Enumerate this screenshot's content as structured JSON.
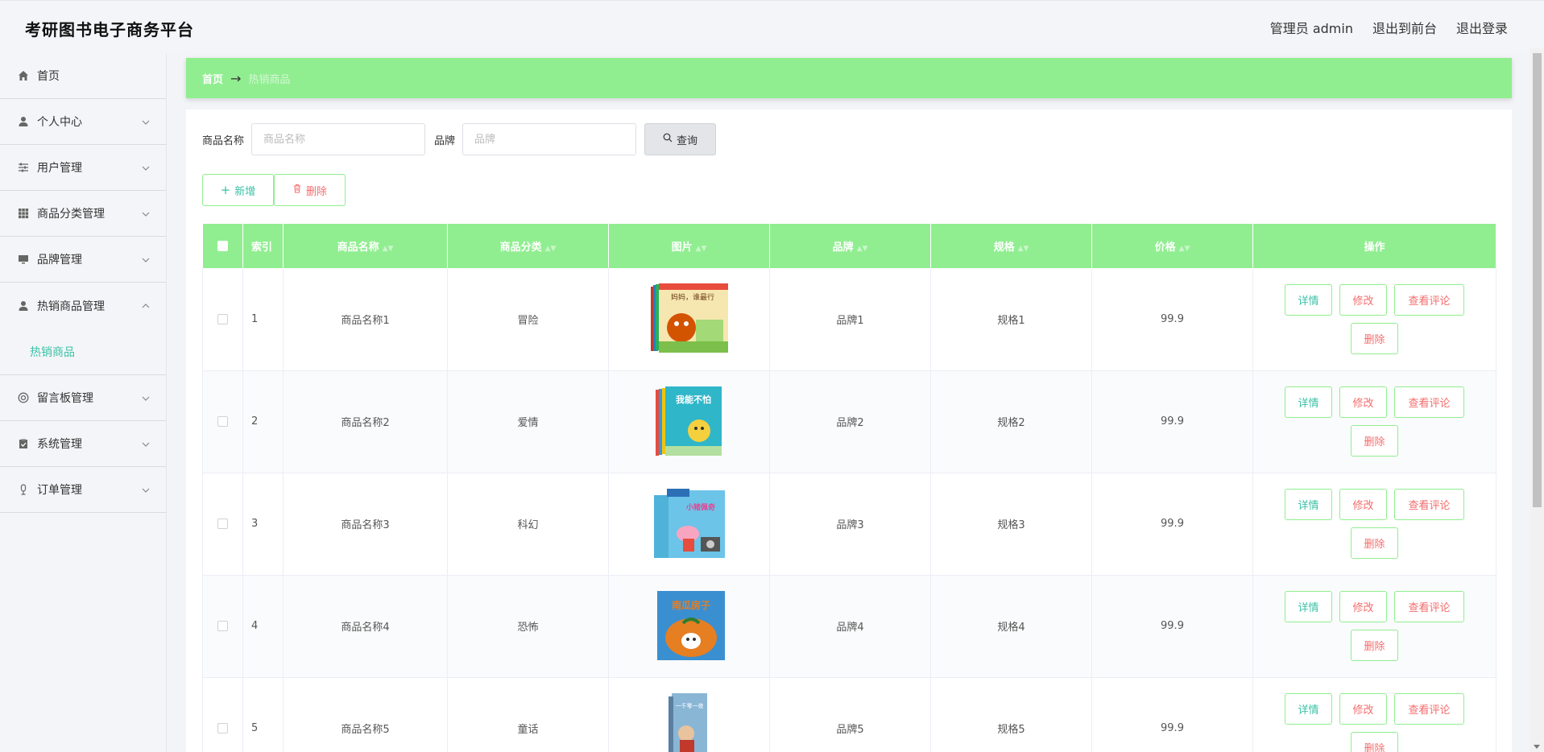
{
  "header": {
    "brand": "考研图书电子商务平台",
    "user_label": "管理员 admin",
    "to_front": "退出到前台",
    "logout": "退出登录"
  },
  "sidebar": {
    "items": [
      {
        "label": "首页",
        "icon": "home-icon"
      },
      {
        "label": "个人中心",
        "icon": "user-icon"
      },
      {
        "label": "用户管理",
        "icon": "sliders-icon"
      },
      {
        "label": "商品分类管理",
        "icon": "grid-icon"
      },
      {
        "label": "品牌管理",
        "icon": "monitor-icon"
      },
      {
        "label": "热销商品管理",
        "icon": "user-icon"
      },
      {
        "label": "留言板管理",
        "icon": "help-icon"
      },
      {
        "label": "系统管理",
        "icon": "clipboard-icon"
      },
      {
        "label": "订单管理",
        "icon": "mic-icon"
      }
    ],
    "submenu_active": "热销商品"
  },
  "breadcrumb": {
    "home": "首页",
    "arrow": "→",
    "current": "热销商品"
  },
  "search": {
    "name_label": "商品名称",
    "name_placeholder": "商品名称",
    "brand_label": "品牌",
    "brand_placeholder": "品牌",
    "query_label": "查询"
  },
  "actions": {
    "add_label": "新增",
    "delete_label": "删除"
  },
  "table": {
    "headers": [
      "索引",
      "商品名称",
      "商品分类",
      "图片",
      "品牌",
      "规格",
      "价格",
      "操作"
    ],
    "rows": [
      {
        "index": "1",
        "name": "商品名称1",
        "category": "冒险",
        "brand": "品牌1",
        "spec": "规格1",
        "price": "99.9"
      },
      {
        "index": "2",
        "name": "商品名称2",
        "category": "爱情",
        "brand": "品牌2",
        "spec": "规格2",
        "price": "99.9"
      },
      {
        "index": "3",
        "name": "商品名称3",
        "category": "科幻",
        "brand": "品牌3",
        "spec": "规格3",
        "price": "99.9"
      },
      {
        "index": "4",
        "name": "商品名称4",
        "category": "恐怖",
        "brand": "品牌4",
        "spec": "规格4",
        "price": "99.9"
      },
      {
        "index": "5",
        "name": "商品名称5",
        "category": "童话",
        "brand": "品牌5",
        "spec": "规格5",
        "price": "99.9"
      }
    ],
    "op_labels": {
      "detail": "详情",
      "edit": "修改",
      "review": "查看评论",
      "delete": "删除"
    },
    "cover_texts": [
      "妈妈，谁最行",
      "我能不怕",
      "小猪佩奇",
      "南瓜房子",
      "一千零一夜"
    ]
  },
  "colors": {
    "accent_green": "#90ee90",
    "teal_text": "#3bc1a6",
    "danger_text": "#f56c6c"
  }
}
